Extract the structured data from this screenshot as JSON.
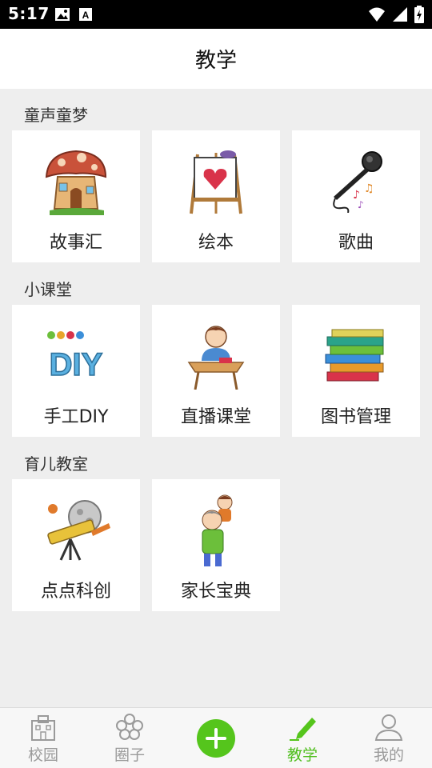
{
  "status_bar": {
    "time": "5:17"
  },
  "header": {
    "title": "教学"
  },
  "sections": [
    {
      "title": "童声童梦",
      "items": [
        {
          "label": "故事汇",
          "icon": "mushroom-house-icon"
        },
        {
          "label": "绘本",
          "icon": "easel-icon"
        },
        {
          "label": "歌曲",
          "icon": "microphone-icon"
        }
      ]
    },
    {
      "title": "小课堂",
      "items": [
        {
          "label": "手工DIY",
          "icon": "diy-icon"
        },
        {
          "label": "直播课堂",
          "icon": "student-desk-icon"
        },
        {
          "label": "图书管理",
          "icon": "book-stack-icon"
        }
      ]
    },
    {
      "title": "育儿教室",
      "items": [
        {
          "label": "点点科创",
          "icon": "telescope-icon"
        },
        {
          "label": "家长宝典",
          "icon": "parent-child-icon"
        }
      ]
    }
  ],
  "diy_art_text": "DIY",
  "bottom_nav": [
    {
      "label": "校园",
      "icon": "school-building-icon",
      "active": false
    },
    {
      "label": "圈子",
      "icon": "flower-circle-icon",
      "active": false
    },
    {
      "label": "",
      "icon": "add-icon",
      "active": false
    },
    {
      "label": "教学",
      "icon": "pencil-icon",
      "active": true
    },
    {
      "label": "我的",
      "icon": "person-icon",
      "active": false
    }
  ],
  "colors": {
    "accent": "#55c51c",
    "background": "#eeeeee",
    "status_bar": "#000000"
  }
}
